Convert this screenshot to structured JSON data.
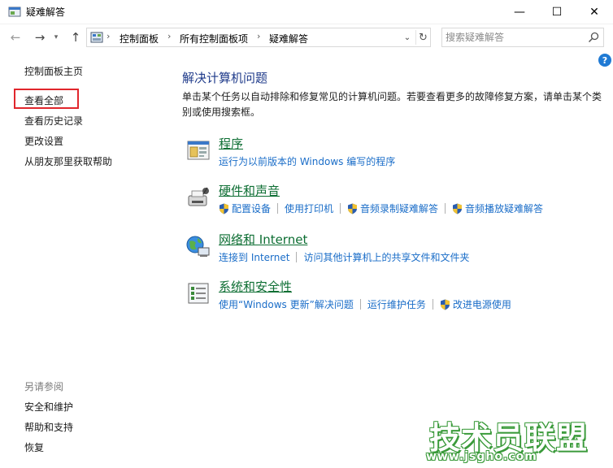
{
  "window": {
    "title": "疑难解答",
    "minimize_glyph": "—",
    "maximize_glyph": "☐",
    "close_glyph": "✕"
  },
  "nav": {
    "back_glyph": "←",
    "forward_glyph": "→",
    "history_glyph": "▾",
    "up_glyph": "↑"
  },
  "address": {
    "breadcrumbs": [
      "控制面板",
      "所有控制面板项",
      "疑难解答"
    ],
    "separator": "›",
    "dropdown_glyph": "⌄",
    "refresh_glyph": "↻"
  },
  "search": {
    "placeholder": "搜索疑难解答",
    "icon": "search-icon"
  },
  "help": {
    "glyph": "?"
  },
  "sidebar": {
    "home": "控制面板主页",
    "view_all": "查看全部",
    "history": "查看历史记录",
    "settings": "更改设置",
    "friend_help": "从朋友那里获取帮助",
    "see_also": "另请参阅",
    "security": "安全和维护",
    "help_support": "帮助和支持",
    "restore": "恢复"
  },
  "main": {
    "title": "解决计算机问题",
    "description": "单击某个任务以自动排除和修复常见的计算机问题。若要查看更多的故障修复方案，请单击某个类别或使用搜索框。",
    "categories": [
      {
        "title": "程序",
        "icon": "programs-icon",
        "links": [
          {
            "label": "运行为以前版本的 Windows 编写的程序",
            "shield": false
          }
        ]
      },
      {
        "title": "硬件和声音",
        "icon": "hardware-sound-icon",
        "links": [
          {
            "label": "配置设备",
            "shield": true
          },
          {
            "label": "使用打印机",
            "shield": false
          },
          {
            "label": "音频录制疑难解答",
            "shield": true
          },
          {
            "label": "音频播放疑难解答",
            "shield": true
          }
        ]
      },
      {
        "title": "网络和 Internet",
        "icon": "network-icon",
        "links": [
          {
            "label": "连接到 Internet",
            "shield": false
          },
          {
            "label": "访问其他计算机上的共享文件和文件夹",
            "shield": false
          }
        ]
      },
      {
        "title": "系统和安全性",
        "icon": "system-security-icon",
        "links": [
          {
            "label": "使用“Windows 更新”解决问题",
            "shield": false
          },
          {
            "label": "运行维护任务",
            "shield": false
          },
          {
            "label": "改进电源使用",
            "shield": true
          }
        ]
      }
    ]
  },
  "watermark": {
    "text": "技术员联盟",
    "url": "www.jsgho.com"
  },
  "colors": {
    "link": "#1a6dc8",
    "heading": "#1e3a8a",
    "category": "#0d6e33",
    "highlight": "#e1262c"
  }
}
